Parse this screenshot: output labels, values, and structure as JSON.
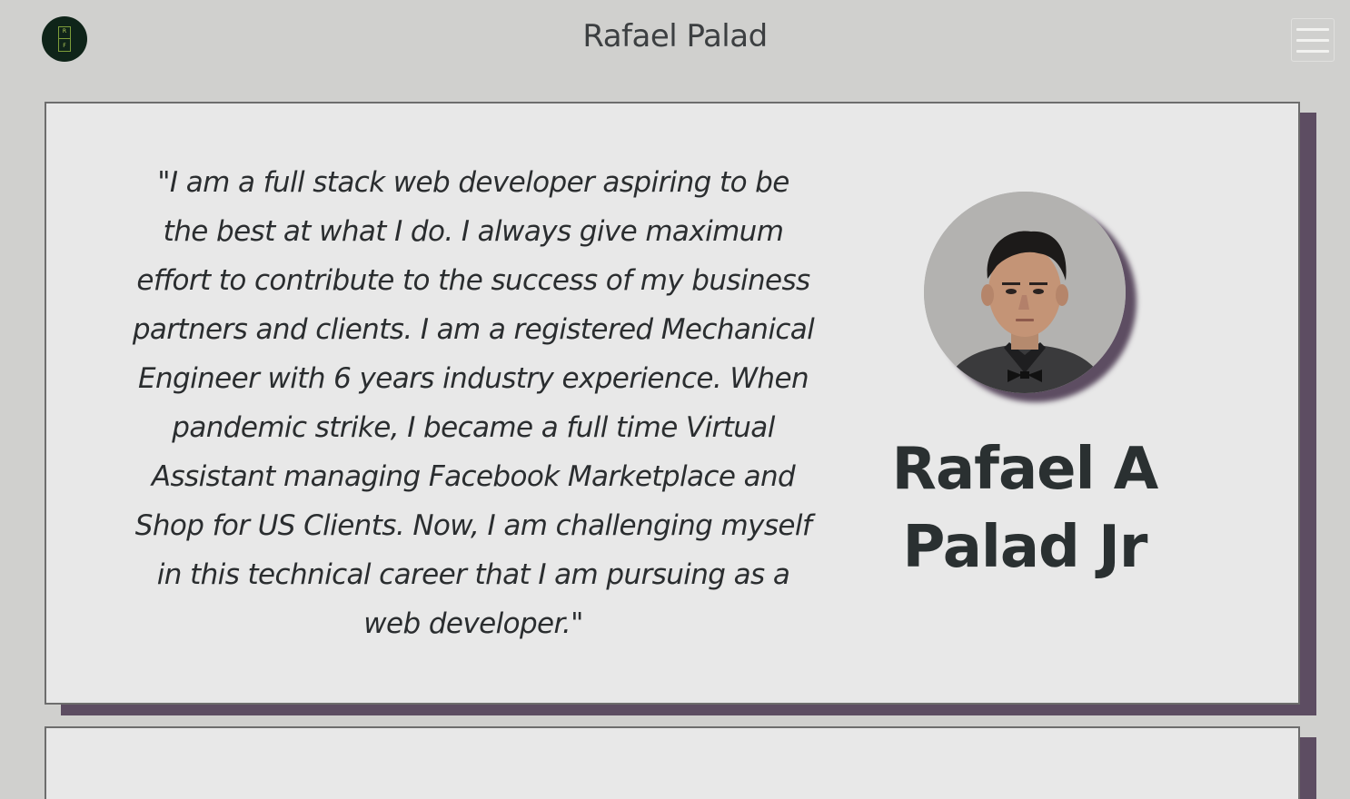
{
  "header": {
    "logo": {
      "letters": [
        "R",
        "F"
      ],
      "icon": "rp-monogram-logo"
    },
    "title": "Rafael Palad",
    "menu_icon": "hamburger-menu-icon"
  },
  "hero": {
    "quote": "\"I am a full stack web developer aspiring to be the best at what I do. I always give maximum effort to contribute to the success of my business partners and clients. I am a registered Mechanical Engineer with 6 years industry experience. When pandemic strike, I became a full time Virtual Assistant managing Facebook Marketplace and Shop for US Clients. Now, I am challenging myself in this technical career that I am pursuing as a web developer.\"",
    "name_line1": "Rafael A",
    "name_line2": "Palad Jr",
    "avatar_icon": "profile-photo"
  },
  "colors": {
    "background": "#d0d0ce",
    "card": "#e8e8e8",
    "card_border": "#6d6d6d",
    "card_shadow": "#5d4d62",
    "text": "#2a2d2f",
    "logo_bg": "#0f2419"
  }
}
